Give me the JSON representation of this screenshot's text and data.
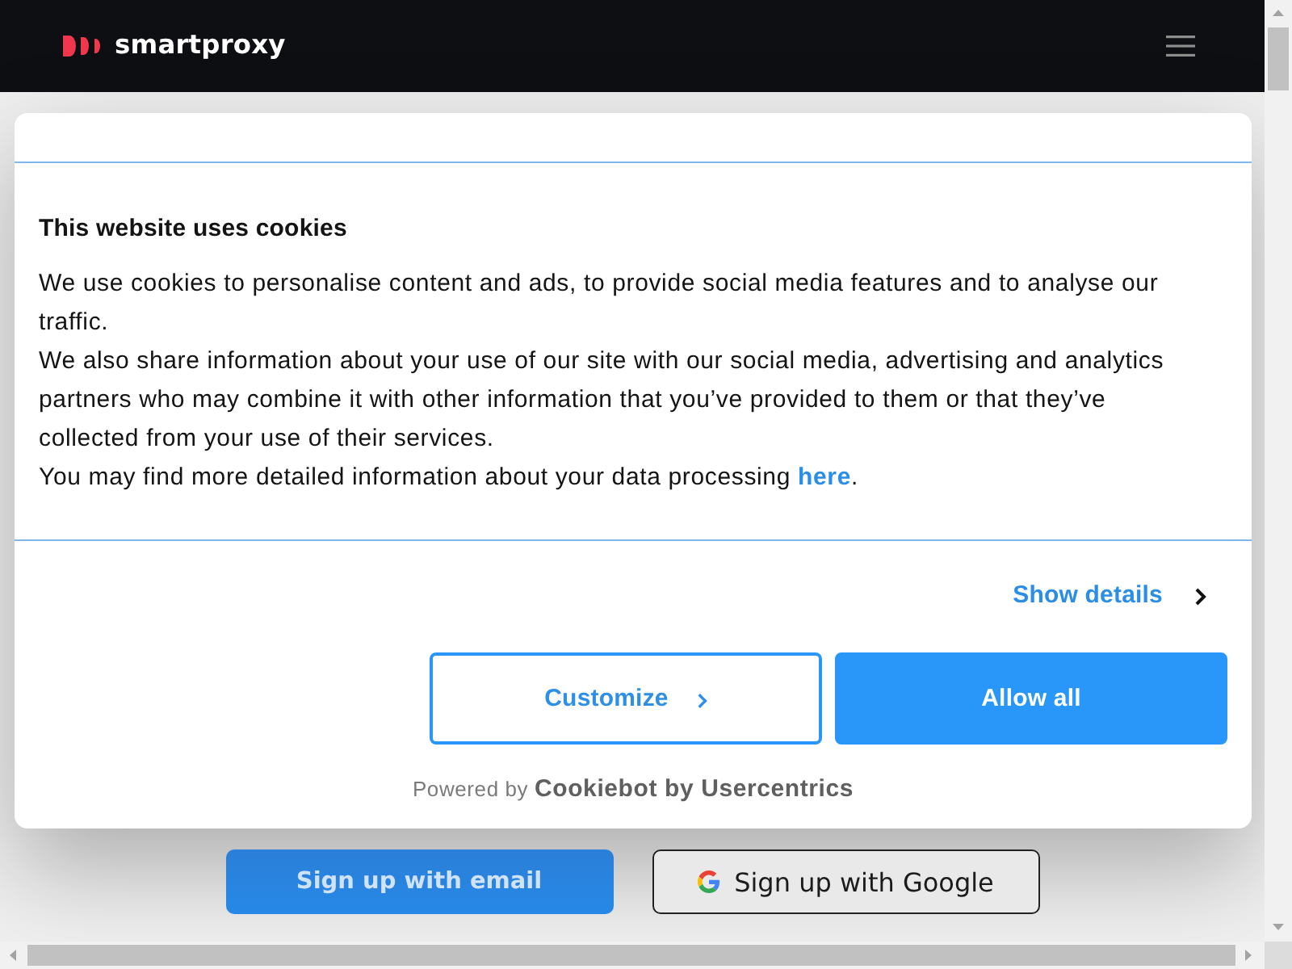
{
  "header": {
    "brand": "smartproxy"
  },
  "cookie_dialog": {
    "title": "This website uses cookies",
    "paragraphs": [
      {
        "text": "We use cookies to personalise content and ads, to provide social media features and to analyse our traffic."
      },
      {
        "text": "We also share information about your use of our site with our social media, advertising and analytics partners who may combine it with other information that you’ve provided to them or that they’ve collected from your use of their services."
      },
      {
        "text": "You may find more detailed information about your data processing",
        "link": "here",
        "end": "."
      }
    ],
    "show_details": "Show details",
    "buttons": [
      {
        "label": "Customize",
        "kind": "outline"
      },
      {
        "label": "Allow all",
        "kind": "filled"
      }
    ],
    "powered_by": "Powered by **Cookiebot by Usercentrics**"
  },
  "signup_buttons": [
    {
      "label": "Sign up with email",
      "kind": "primary"
    },
    {
      "label": "Sign up with Google",
      "kind": "google"
    }
  ]
}
